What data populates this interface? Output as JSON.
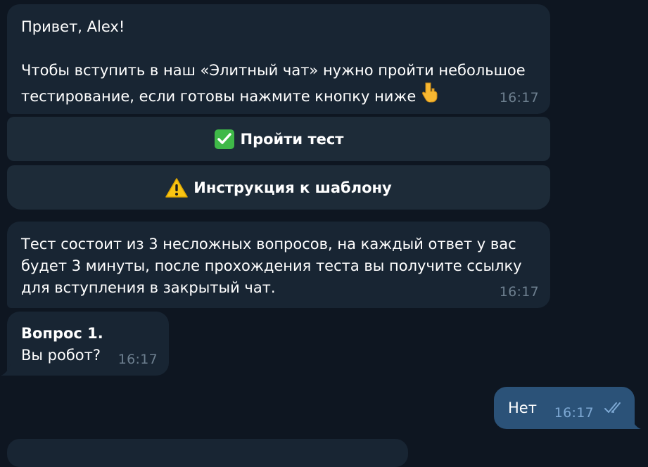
{
  "messages": {
    "greeting": {
      "line1": "Привет, Alex!",
      "line2": "Чтобы вступить в наш «Элитный чат» нужно пройти небольшое",
      "line3": "тестирование, если готовы нажмите кнопку ниже",
      "hand_emoji": "hand-pointing-down-icon",
      "time": "16:17"
    },
    "buttons": {
      "take_test": {
        "label": "Пройти тест",
        "icon": "check-mark-button-icon"
      },
      "template_guide": {
        "label": "Инструкция к шаблону",
        "icon": "warning-icon"
      }
    },
    "test_info": {
      "text": "Тест состоит из 3 несложных вопросов, на каждый ответ у вас будет 3 минуты, после прохождения теста вы получите ссылку для вступления в закрытый чат.",
      "line1": "Тест состоит из 3 несложных вопросов, на каждый ответ у вас",
      "line2": "будет 3 минуты, после прохождения теста вы получите ссылку",
      "line3": "для вступления в закрытый чат.",
      "time": "16:17"
    },
    "question": {
      "title": "Вопрос 1.",
      "body": "Вы робот?",
      "time": "16:17"
    },
    "reply": {
      "text": "Нет",
      "time": "16:17",
      "status": "read"
    }
  },
  "colors": {
    "background": "#0e1621",
    "incoming_bubble": "#182533",
    "outgoing_bubble": "#2b5278",
    "button": "#1d2b38",
    "time_text": "#6d7f8f",
    "read_checks": "#7da8d3"
  }
}
